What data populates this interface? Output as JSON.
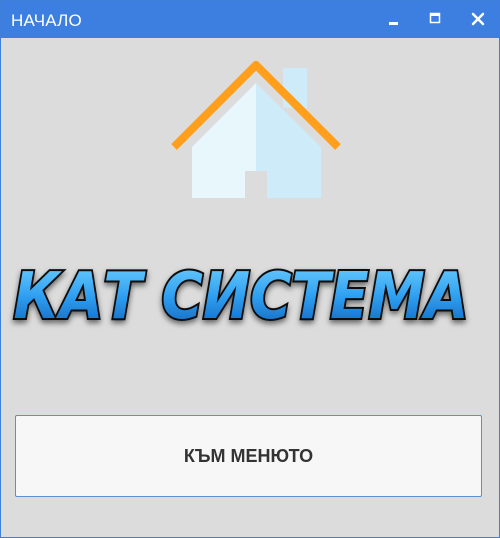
{
  "window": {
    "title": "НАЧАЛО"
  },
  "titlebar_buttons": {
    "minimize_icon": "minimize-icon",
    "maximize_icon": "maximize-icon",
    "close_icon": "close-icon"
  },
  "logo": {
    "text": "КАТ СИСТЕМА",
    "colors": {
      "fill_top": "#5fc4ff",
      "fill_bottom": "#1565c0",
      "outline": "#0a0a0a"
    }
  },
  "house": {
    "icon": "house-icon",
    "colors": {
      "roof": "#ff9f1c",
      "wall_light": "#e8f7fc",
      "wall_shade": "#cdebf8",
      "chimney": "#cdebf8",
      "door": "#dcdcdc"
    }
  },
  "main_button": {
    "label": "КЪМ МЕНЮТО"
  },
  "colors": {
    "titlebar": "#3c7fe0",
    "background": "#dcdcdc",
    "button_border": "#5b8fd0"
  }
}
